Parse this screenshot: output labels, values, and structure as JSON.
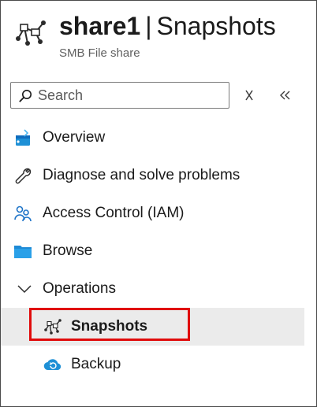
{
  "header": {
    "resource_name": "share1",
    "separator": "|",
    "page_title": "Snapshots",
    "subtitle": "SMB File share",
    "icon": "file-share-snapshot-icon"
  },
  "search": {
    "placeholder": "Search",
    "value": "",
    "icon": "search-icon"
  },
  "toolbar": {
    "clear_icon": "clear-icon",
    "collapse_icon": "collapse-double-chevron-icon"
  },
  "nav": {
    "items": [
      {
        "label": "Overview",
        "icon": "overview-icon"
      },
      {
        "label": "Diagnose and solve problems",
        "icon": "wrench-icon"
      },
      {
        "label": "Access Control (IAM)",
        "icon": "people-icon"
      },
      {
        "label": "Browse",
        "icon": "folder-icon"
      },
      {
        "label": "Operations",
        "icon": "chevron-down-icon",
        "expanded": true
      },
      {
        "label": "Snapshots",
        "icon": "snapshot-icon",
        "selected": true
      },
      {
        "label": "Backup",
        "icon": "cloud-backup-icon"
      }
    ]
  },
  "colors": {
    "selected_background": "#ebebeb",
    "highlight_border": "#e00b0b",
    "accent_blue": "#1e90d6"
  }
}
